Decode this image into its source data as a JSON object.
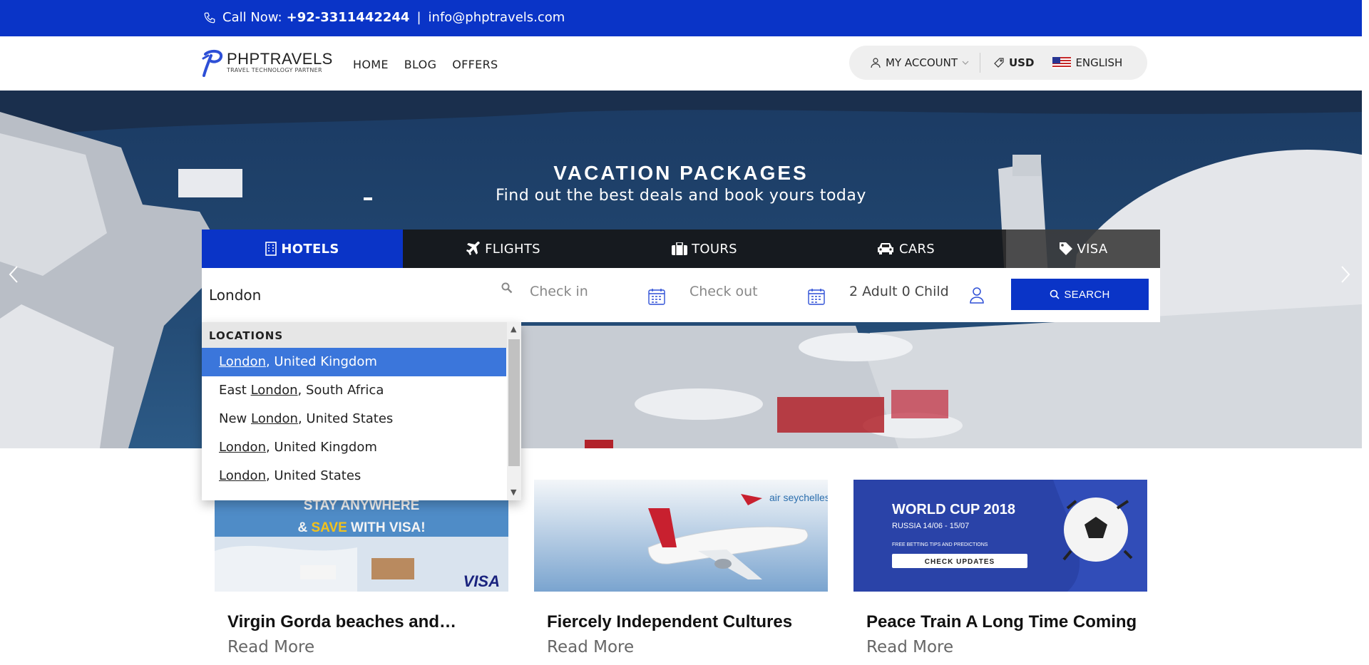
{
  "topbar": {
    "call_label": "Call Now:",
    "phone": "+92-3311442244",
    "separator": "|",
    "email": "info@phptravels.com"
  },
  "nav": {
    "logo_brand": "PHPTRAVELS",
    "logo_tagline": "TRAVEL TECHNOLOGY PARTNER",
    "menu": [
      "HOME",
      "BLOG",
      "OFFERS"
    ],
    "account_label": "MY ACCOUNT",
    "currency": "USD",
    "language": "ENGLISH"
  },
  "hero": {
    "title": "VACATION PACKAGES",
    "subtitle": "Find out the best deals and book yours today"
  },
  "tabs": [
    {
      "label": "HOTELS",
      "active": true,
      "icon": "building-icon"
    },
    {
      "label": "FLIGHTS",
      "active": false,
      "icon": "plane-icon"
    },
    {
      "label": "TOURS",
      "active": false,
      "icon": "suitcase-icon"
    },
    {
      "label": "CARS",
      "active": false,
      "icon": "car-icon"
    },
    {
      "label": "VISA",
      "active": false,
      "icon": "tag-icon"
    }
  ],
  "search": {
    "location_value": "London",
    "checkin_placeholder": "Check in",
    "checkout_placeholder": "Check out",
    "guests": "2 Adult 0 Child",
    "button_label": "SEARCH"
  },
  "dropdown": {
    "header": "LOCATIONS",
    "items": [
      {
        "match": "London",
        "before": "",
        "after": ", United Kingdom",
        "selected": true
      },
      {
        "match": "London",
        "before": "East ",
        "after": ", South Africa",
        "selected": false
      },
      {
        "match": "London",
        "before": "New ",
        "after": ", United States",
        "selected": false
      },
      {
        "match": "London",
        "before": "",
        "after": ", United Kingdom",
        "selected": false
      },
      {
        "match": "London",
        "before": "",
        "after": ", United States",
        "selected": false
      }
    ]
  },
  "cards": [
    {
      "title": "Virgin Gorda beaches and…",
      "read_more": "Read More",
      "banner_line1": "STAY ANYWHERE",
      "banner_line2a": "& ",
      "banner_line2b": "SAVE",
      "banner_line2c": " WITH VISA!",
      "brand": "VISA"
    },
    {
      "title": "Fiercely Independent Cultures",
      "read_more": "Read More",
      "brand": "air seychelles"
    },
    {
      "title": "Peace Train A Long Time Coming",
      "read_more": "Read More",
      "banner_line1": "WORLD CUP 2018",
      "banner_line2": "RUSSIA 14/06 - 15/07",
      "banner_line3": "FREE BETTING TIPS AND PREDICTIONS",
      "banner_button": "CHECK UPDATES"
    }
  ],
  "colors": {
    "brand_blue": "#0a34c7",
    "selected_blue": "#3b76db",
    "tab_dark": "#141414"
  }
}
